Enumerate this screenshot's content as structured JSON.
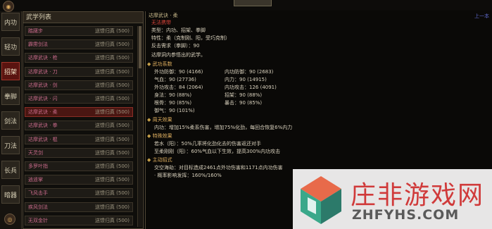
{
  "top_tab": "",
  "tabs": [
    "内功",
    "轻功",
    "招架",
    "拳脚",
    "剑法",
    "刀法",
    "长兵",
    "暗器"
  ],
  "active_tab": "招架",
  "list": {
    "header": "武学列表",
    "items": [
      {
        "name": "踏躇步",
        "status": "送馈归真 (500)"
      },
      {
        "name": "霹雳剑法",
        "status": "送馈归真 (500)"
      },
      {
        "name": "达摩武诀 · 枪",
        "status": "送馈归真 (500)"
      },
      {
        "name": "达摩武诀 · 刀",
        "status": "送馈归真 (500)"
      },
      {
        "name": "达摩武诀 · 剑",
        "status": "送馈归真 (500)"
      },
      {
        "name": "达摩武诀 · 闪",
        "status": "送馈归真 (500)"
      },
      {
        "name": "达摩武诀 · 柔",
        "status": "送馈归真 (500)"
      },
      {
        "name": "达摩武诀 · 拳",
        "status": "送馈归真 (500)"
      },
      {
        "name": "达摩武诀 · 棍",
        "status": "送馈归真 (500)"
      },
      {
        "name": "天灵剑",
        "status": "送馈归真 (500)"
      },
      {
        "name": "多罗叶指",
        "status": "送馈归真 (500)"
      },
      {
        "name": "逍遥掌",
        "status": "送馈归真 (500)"
      },
      {
        "name": "飞风击手",
        "status": "送馈归真 (500)"
      },
      {
        "name": "疾风剑法",
        "status": "送馈归真 (500)"
      },
      {
        "name": "无双金针",
        "status": "送馈归真 (500)"
      }
    ]
  },
  "detail": {
    "header": "达摩武诀 · 柔",
    "corner": "上一本",
    "subtitle": "无法携带",
    "type_line": "类型：内功、招架、拳脚",
    "trait_line": "特性：柔（克制刚、阳，受巧克制）",
    "condition_line": "反击需求（拳脚）：90",
    "desc": "达摩洞内参悟出的武学。",
    "attr_header": "武功系数",
    "attrs": [
      [
        "外功防御：90 (4166)",
        "内功防御：90 (2683)"
      ],
      [
        "气血：90 (27736)",
        "内力：90 (14915)"
      ],
      [
        "外功攻击：84 (2064)",
        "内功攻击：126 (4091)"
      ],
      [
        "身法：90 (88%)",
        "招架：90 (88%)"
      ],
      [
        "根骨：90 (85%)",
        "暴击：90 (85%)"
      ],
      [
        "御气：90 (101%)",
        ""
      ]
    ],
    "effect_header": "周天效果",
    "effect_line": "内功：增加15%柔系伤害，增加75%化劲，每回合恢复6%内力",
    "special_header": "特殊效果",
    "special_1": "若水（阳）：50%几率将化劲化去的伤害返还对手",
    "special_2": "至柔刚刚（阳）：60%气血以下生效，提高300%内功攻击",
    "active_header": "主动招式",
    "active_line": "交空海劫：对目标造成2461点外功伤害和1171点内功伤害",
    "active_sub": "· 概率影响发挥：160%/160%"
  },
  "watermark": {
    "cn": "庄非游戏网",
    "en": "ZHFYHS.COM"
  },
  "colors": {
    "selected": "#4a1612",
    "active_tab": "#5a1410",
    "accent_red": "#d8443a",
    "accent_gold": "#e0b060"
  }
}
